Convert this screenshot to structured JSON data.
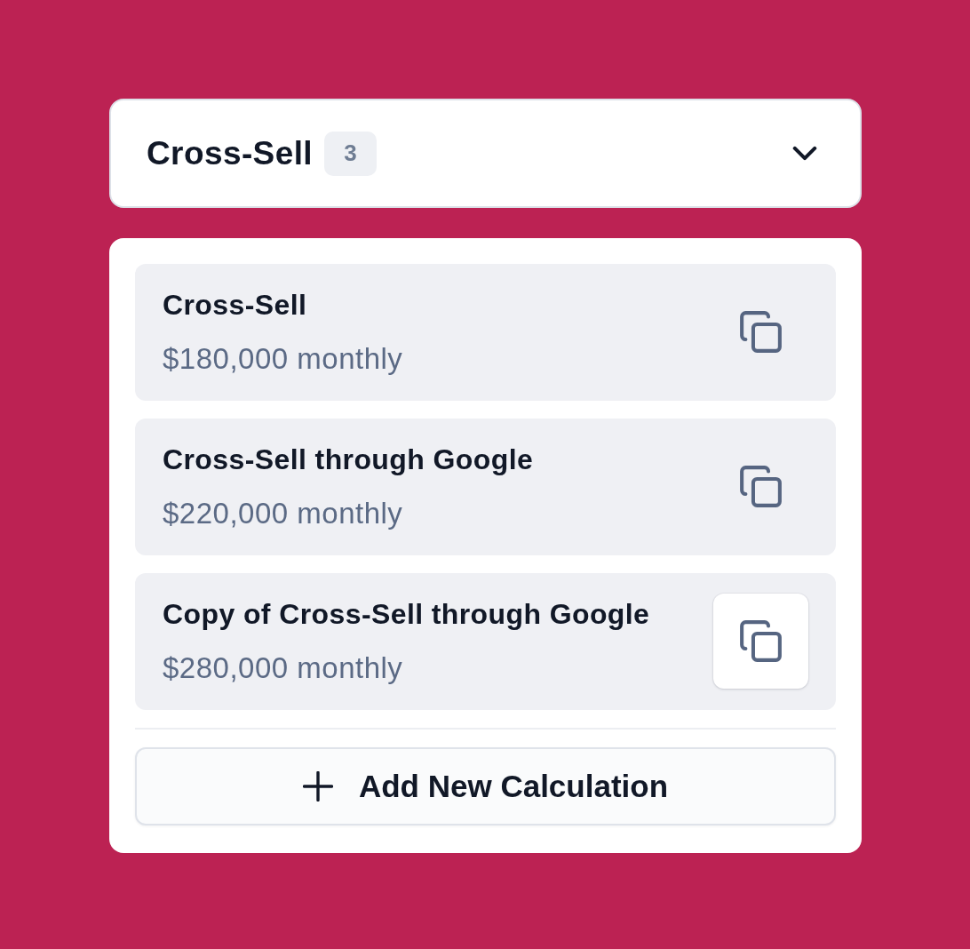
{
  "header": {
    "title": "Cross-Sell",
    "count": "3",
    "expanded": true
  },
  "calculations": [
    {
      "name": "Cross-Sell",
      "amount": "$180,000 monthly",
      "hovered": false
    },
    {
      "name": "Cross-Sell through Google",
      "amount": "$220,000 monthly",
      "hovered": false
    },
    {
      "name": "Copy of Cross-Sell through Google",
      "amount": "$280,000 monthly",
      "hovered": true
    }
  ],
  "add_button": {
    "label": "Add New Calculation"
  }
}
